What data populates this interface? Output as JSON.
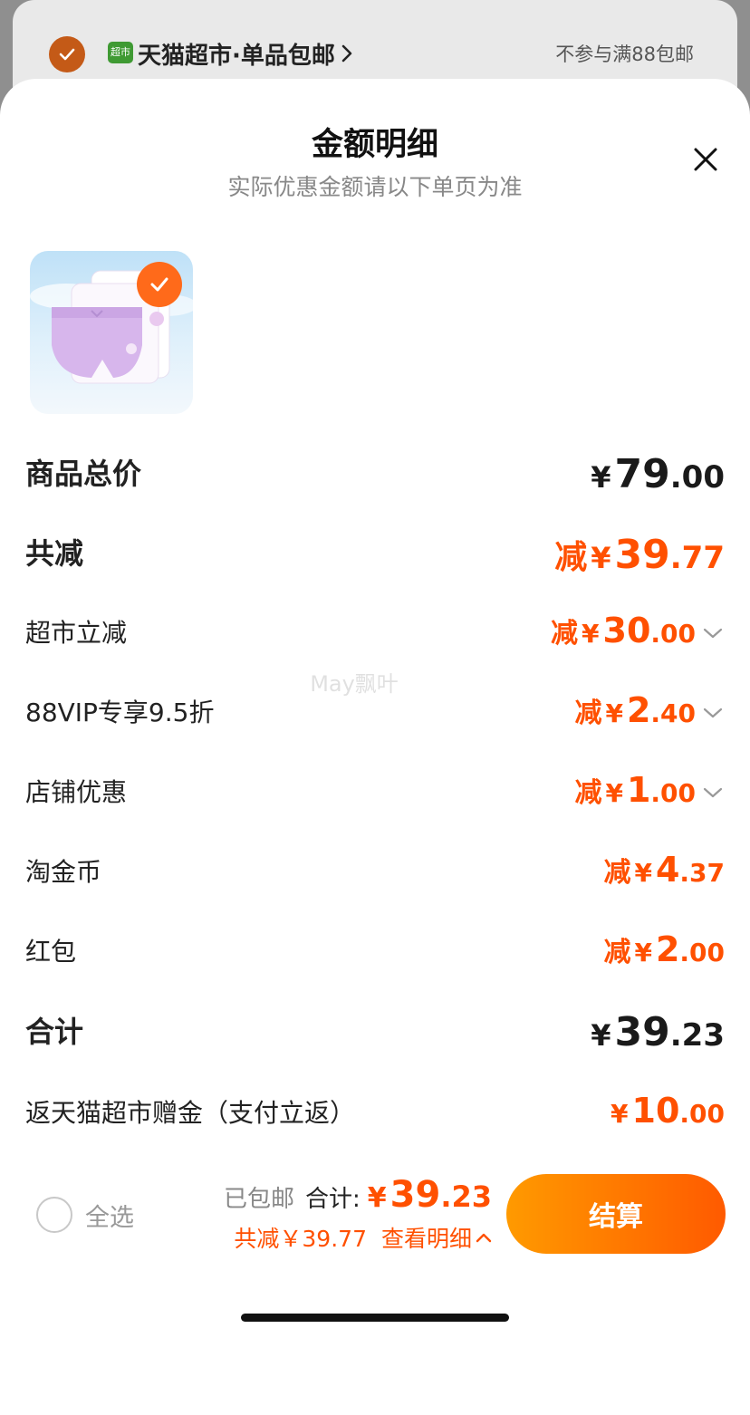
{
  "shop_bar": {
    "badge": "超市",
    "name": "天猫超市·单品包邮",
    "note": "不参与满88包邮"
  },
  "sheet": {
    "title": "金额明细",
    "subtitle": "实际优惠金额请以下单页为准"
  },
  "rows": {
    "goods_total": {
      "label": "商品总价",
      "prefix": "",
      "int": "79",
      "dec": ".00"
    },
    "total_reduce": {
      "label": "共减",
      "prefix": "减",
      "int": "39",
      "dec": ".77"
    },
    "supermarket": {
      "label": "超市立减",
      "prefix": "减",
      "int": "30",
      "dec": ".00"
    },
    "vip": {
      "label": "88VIP专享9.5折",
      "prefix": "减",
      "int": "2",
      "dec": ".40"
    },
    "store": {
      "label": "店铺优惠",
      "prefix": "减",
      "int": "1",
      "dec": ".00"
    },
    "coins": {
      "label": "淘金币",
      "prefix": "减",
      "int": "4",
      "dec": ".37"
    },
    "redpacket": {
      "label": "红包",
      "prefix": "减",
      "int": "2",
      "dec": ".00"
    },
    "sum": {
      "label": "合计",
      "prefix": "",
      "int": "39",
      "dec": ".23"
    },
    "cashback": {
      "label": "返天猫超市赠金（支付立返）",
      "prefix": "",
      "int": "10",
      "dec": ".00"
    }
  },
  "currency": "¥",
  "watermark": "May飘叶",
  "bottom_bar": {
    "select_all": "全选",
    "shipping": "已包邮",
    "total_label": "合计:",
    "total_int": "39",
    "total_dec": ".23",
    "reduce_text": "共减￥39.77",
    "details_link": "查看明细",
    "checkout": "结算"
  },
  "colors": {
    "accent": "#ff5000",
    "checkout_start": "#ff9a00",
    "checkout_end": "#ff5a00"
  }
}
